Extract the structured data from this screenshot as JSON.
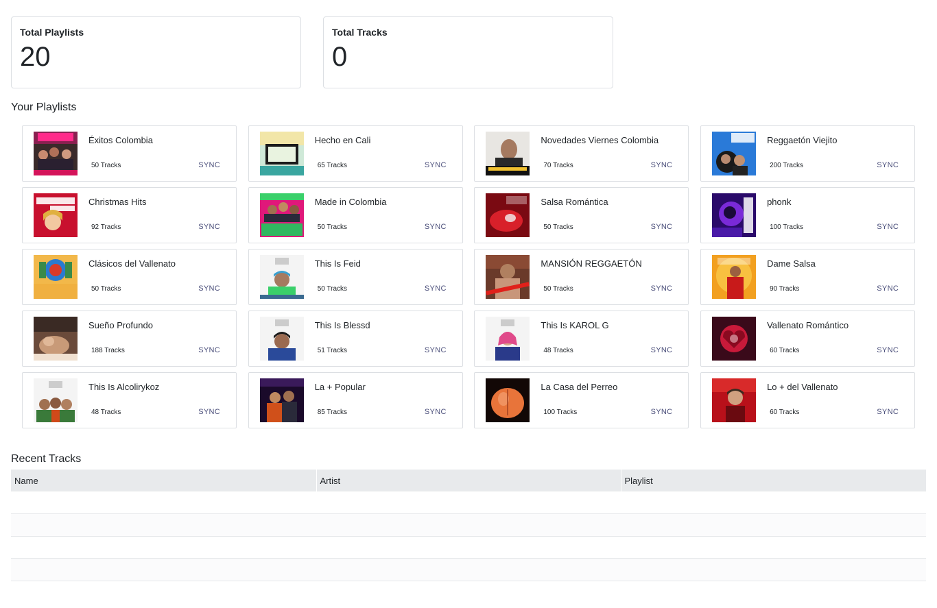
{
  "stats": {
    "playlists_label": "Total Playlists",
    "playlists_value": "20",
    "tracks_label": "Total Tracks",
    "tracks_value": "0"
  },
  "sections": {
    "playlists_heading": "Your Playlists",
    "recent_heading": "Recent Tracks"
  },
  "playlists": [
    {
      "name": "Éxitos Colombia",
      "count": "50 Tracks",
      "sync": "SYNC"
    },
    {
      "name": "Hecho en Cali",
      "count": "65 Tracks",
      "sync": "SYNC"
    },
    {
      "name": "Novedades Viernes Colombia",
      "count": "70 Tracks",
      "sync": "SYNC"
    },
    {
      "name": "Reggaetón Viejito",
      "count": "200 Tracks",
      "sync": "SYNC"
    },
    {
      "name": "Christmas Hits",
      "count": "92 Tracks",
      "sync": "SYNC"
    },
    {
      "name": "Made in Colombia",
      "count": "50 Tracks",
      "sync": "SYNC"
    },
    {
      "name": "Salsa Romántica",
      "count": "50 Tracks",
      "sync": "SYNC"
    },
    {
      "name": "phonk",
      "count": "100 Tracks",
      "sync": "SYNC"
    },
    {
      "name": "Clásicos del Vallenato",
      "count": "50 Tracks",
      "sync": "SYNC"
    },
    {
      "name": "This Is Feid",
      "count": "50 Tracks",
      "sync": "SYNC"
    },
    {
      "name": "MANSIÓN REGGAETÓN",
      "count": "50 Tracks",
      "sync": "SYNC"
    },
    {
      "name": "Dame Salsa",
      "count": "90 Tracks",
      "sync": "SYNC"
    },
    {
      "name": "Sueño Profundo",
      "count": "188 Tracks",
      "sync": "SYNC"
    },
    {
      "name": "This Is Blessd",
      "count": "51 Tracks",
      "sync": "SYNC"
    },
    {
      "name": "This Is KAROL G",
      "count": "48 Tracks",
      "sync": "SYNC"
    },
    {
      "name": "Vallenato Romántico",
      "count": "60 Tracks",
      "sync": "SYNC"
    },
    {
      "name": "This Is Alcolirykoz",
      "count": "48 Tracks",
      "sync": "SYNC"
    },
    {
      "name": "La + Popular",
      "count": "85 Tracks",
      "sync": "SYNC"
    },
    {
      "name": "La Casa del Perreo",
      "count": "100 Tracks",
      "sync": "SYNC"
    },
    {
      "name": "Lo + del Vallenato",
      "count": "60 Tracks",
      "sync": "SYNC"
    }
  ],
  "recent_table": {
    "columns": [
      "Name",
      "Artist",
      "Playlist"
    ]
  },
  "colors": {
    "sync_link": "#4a4e7a",
    "card_border": "#dcdfe3",
    "table_header_bg": "#e8eaec"
  }
}
